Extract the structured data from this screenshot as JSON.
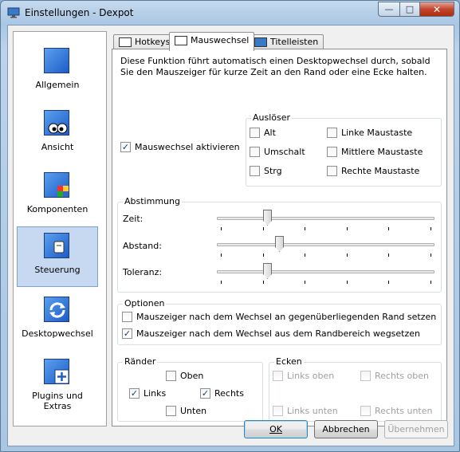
{
  "window": {
    "title": "Einstellungen - Dexpot"
  },
  "sidebar": {
    "items": [
      {
        "label": "Allgemein",
        "icon": "general-icon",
        "active": false
      },
      {
        "label": "Ansicht",
        "icon": "eyes-icon",
        "active": false
      },
      {
        "label": "Komponenten",
        "icon": "components-icon",
        "active": false
      },
      {
        "label": "Steuerung",
        "icon": "control-icon",
        "active": true
      },
      {
        "label": "Desktopwechsel",
        "icon": "refresh-icon",
        "active": false
      },
      {
        "label": "Plugins und Extras",
        "icon": "plus-icon",
        "active": false
      }
    ]
  },
  "tabs": [
    {
      "label": "Hotkeys",
      "active": false
    },
    {
      "label": "Mauswechsel",
      "active": true
    },
    {
      "label": "Titelleisten",
      "active": false
    }
  ],
  "panel": {
    "description": "Diese Funktion führt automatisch einen Desktopwechsel durch, sobald Sie den Mauszeiger für kurze Zeit an den Rand oder eine Ecke halten.",
    "activate_label": "Mauswechsel aktivieren",
    "activate_checked": true,
    "trigger": {
      "legend": "Auslöser",
      "options": [
        {
          "label": "Alt",
          "checked": false
        },
        {
          "label": "Linke Maustaste",
          "checked": false
        },
        {
          "label": "Umschalt",
          "checked": false
        },
        {
          "label": "Mittlere Maustaste",
          "checked": false
        },
        {
          "label": "Strg",
          "checked": false
        },
        {
          "label": "Rechte Maustaste",
          "checked": false
        }
      ]
    },
    "tuning": {
      "legend": "Abstimmung",
      "sliders": [
        {
          "label": "Zeit:",
          "value_fraction": 0.22
        },
        {
          "label": "Abstand:",
          "value_fraction": 0.28
        },
        {
          "label": "Toleranz:",
          "value_fraction": 0.22
        }
      ]
    },
    "options": {
      "legend": "Optionen",
      "items": [
        {
          "label": "Mauszeiger nach dem Wechsel an gegenüberliegenden Rand setzen",
          "checked": false
        },
        {
          "label": "Mauszeiger nach dem Wechsel aus dem Randbereich wegsetzen",
          "checked": true
        }
      ]
    },
    "edges": {
      "legend": "Ränder",
      "top": {
        "label": "Oben",
        "checked": false
      },
      "left": {
        "label": "Links",
        "checked": true
      },
      "right": {
        "label": "Rechts",
        "checked": true
      },
      "bottom": {
        "label": "Unten",
        "checked": false
      }
    },
    "corners": {
      "legend": "Ecken",
      "top_left": {
        "label": "Links oben",
        "checked": false
      },
      "top_right": {
        "label": "Rechts oben",
        "checked": false
      },
      "bottom_left": {
        "label": "Links unten",
        "checked": false
      },
      "bottom_right": {
        "label": "Rechts unten",
        "checked": false
      }
    }
  },
  "buttons": {
    "ok": "OK",
    "cancel": "Abbrechen",
    "apply": "Übernehmen"
  },
  "colors": {
    "accent": "#c7d9f0",
    "icon_blue": "#1e5cc8",
    "check": "#1c3c74"
  }
}
